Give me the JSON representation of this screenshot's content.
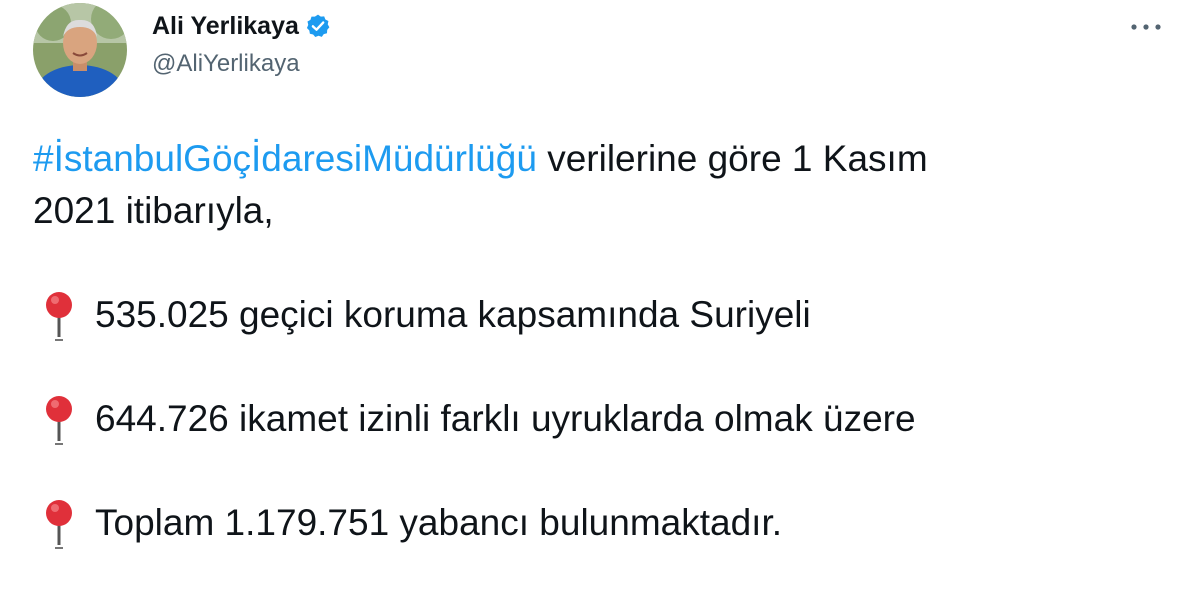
{
  "tweet": {
    "author": {
      "display_name": "Ali Yerlikaya",
      "handle": "@AliYerlikaya",
      "verified": true
    },
    "body": {
      "hashtag": "#İstanbulGöçİdaresiMüdürlüğü",
      "intro_rest": " verilerine göre 1 Kasım",
      "intro_line2": "2021 itibarıyla,",
      "bullets": [
        "535.025 geçici koruma kapsamında Suriyeli",
        "644.726 ikamet izinli farklı uyruklarda olmak üzere",
        "Toplam 1.179.751 yabancı bulunmaktadır."
      ]
    }
  },
  "colors": {
    "link": "#1d9bf0",
    "text": "#0f1419",
    "secondary": "#536471",
    "verified_badge": "#1d9bf0",
    "pin_head": "#e0303a"
  },
  "icons": {
    "verified": "verified-badge-icon",
    "more": "more-dots-icon",
    "bullet": "round-pushpin-icon"
  }
}
